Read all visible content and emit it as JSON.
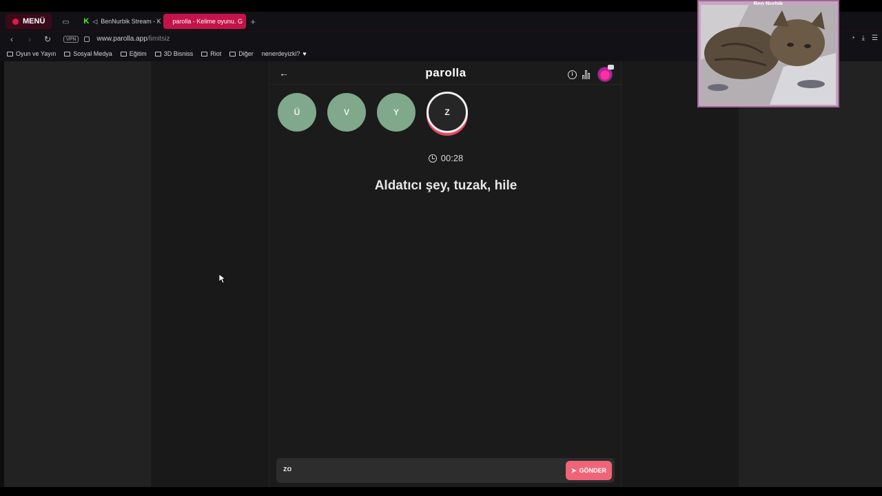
{
  "browser": {
    "menu_label": "MENÜ",
    "tabs": [
      {
        "label": "BenNurbik Stream - K"
      },
      {
        "label": "parolla - Kelime oyunu. G"
      }
    ],
    "new_tab": "+",
    "vpn_label": "VPN",
    "url_domain": "www.parolla.app",
    "url_path": "/limitsiz",
    "bookmarks": [
      {
        "label": "Oyun ve Yayın"
      },
      {
        "label": "Sosyal Medya"
      },
      {
        "label": "Eğitim"
      },
      {
        "label": "3D Bisniss"
      },
      {
        "label": "Riot"
      },
      {
        "label": "Diğer"
      },
      {
        "label": "nenerdeyizki?"
      }
    ]
  },
  "game": {
    "logo": "parolla",
    "info_glyph": "i",
    "letters": [
      {
        "char": "Ü",
        "state": "correct"
      },
      {
        "char": "V",
        "state": "correct"
      },
      {
        "char": "Y",
        "state": "correct"
      },
      {
        "char": "Z",
        "state": "current"
      }
    ],
    "timer": "00:28",
    "question": "Aldatıcı şey, tuzak, hile",
    "answer_value": "zo",
    "send_label": "GÖNDER"
  },
  "webcam": {
    "title": "Ben Nurbik"
  },
  "colors": {
    "brand_red": "#c4134a",
    "letter_green": "#7fa98a",
    "send_pink": "#ef6577"
  }
}
